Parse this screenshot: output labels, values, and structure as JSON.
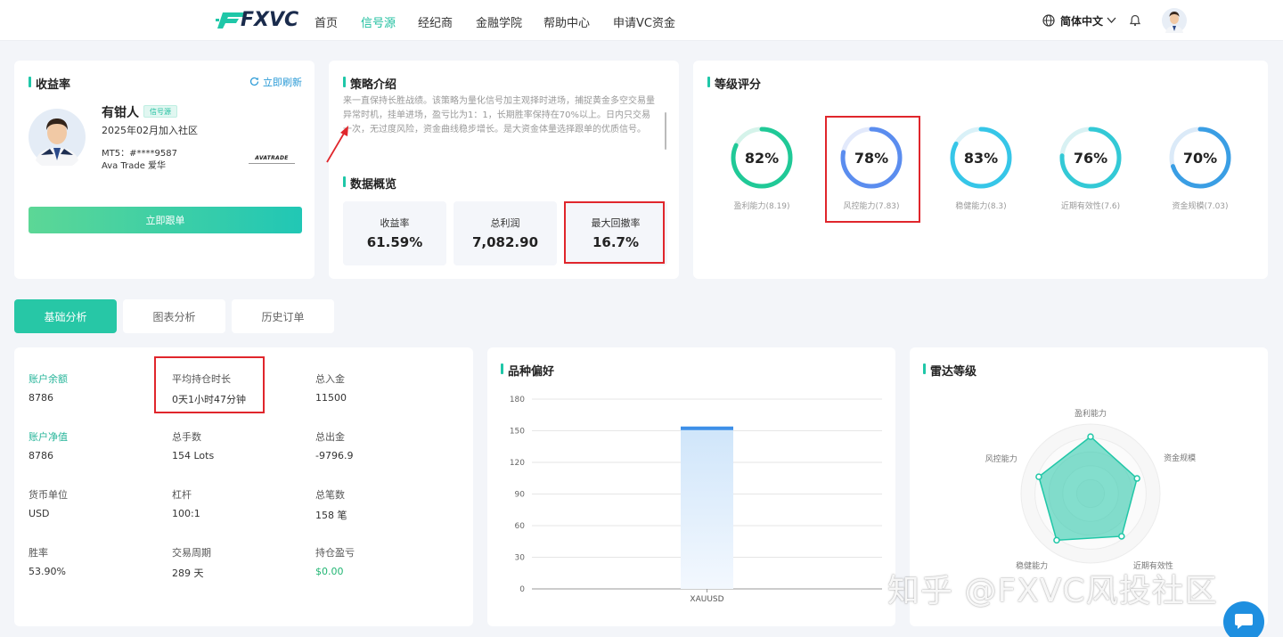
{
  "header": {
    "logo": "FXVC",
    "nav": [
      "首页",
      "信号源",
      "经纪商",
      "金融学院",
      "帮助中心",
      "申请VC资金"
    ],
    "active_nav": "信号源",
    "language": "简体中文"
  },
  "profile": {
    "section_title": "收益率",
    "refresh": "立即刷新",
    "name": "有钳人",
    "badge": "信号源",
    "joined": "2025年02月加入社区",
    "mt5": "MT5：#****9587",
    "broker": "Ava Trade 爱华",
    "broker_logo": "AVATRADE",
    "follow_button": "立即跟单"
  },
  "strategy": {
    "title": "策略介绍",
    "text": "来一直保持长胜战绩。该策略为量化信号加主观择时进场，捕捉黄金多空交易量异常时机，挂单进场，盈亏比为1：1，长期胜率保持在70%以上。日内只交易一次，无过度风险，资金曲线稳步增长。是大资金体量选择跟单的优质信号。"
  },
  "overview": {
    "title": "数据概览",
    "items": [
      {
        "label": "收益率",
        "value": "61.59%"
      },
      {
        "label": "总利润",
        "value": "7,082.90"
      },
      {
        "label": "最大回撤率",
        "value": "16.7%"
      }
    ]
  },
  "rating": {
    "title": "等级评分",
    "gauges": [
      {
        "pct": "82%",
        "value": 82,
        "label": "盈利能力(8.19)",
        "color": "#20c997",
        "track": "#d5f3ea"
      },
      {
        "pct": "78%",
        "value": 78,
        "label": "风控能力(7.83)",
        "color": "#5b8def",
        "track": "#e2e9fb"
      },
      {
        "pct": "83%",
        "value": 83,
        "label": "稳健能力(8.3)",
        "color": "#36c6e8",
        "track": "#d9f1f8"
      },
      {
        "pct": "76%",
        "value": 76,
        "label": "近期有效性(7.6)",
        "color": "#33c9d6",
        "track": "#d8f1f3"
      },
      {
        "pct": "70%",
        "value": 70,
        "label": "资金规模(7.03)",
        "color": "#3a9ee4",
        "track": "#dbeaf8"
      }
    ]
  },
  "tabs": [
    "基础分析",
    "图表分析",
    "历史订单"
  ],
  "stats": [
    {
      "label": "账户余额",
      "value": "8786",
      "accent": true
    },
    {
      "label": "平均持仓时长",
      "value": "0天1小时47分钟"
    },
    {
      "label": "总入金",
      "value": "11500"
    },
    {
      "label": "账户净值",
      "value": "8786",
      "accent": true
    },
    {
      "label": "总手数",
      "value": "154 Lots"
    },
    {
      "label": "总出金",
      "value": "-9796.9"
    },
    {
      "label": "货币单位",
      "value": "USD"
    },
    {
      "label": "杠杆",
      "value": "100:1"
    },
    {
      "label": "总笔数",
      "value": "158 笔"
    },
    {
      "label": "胜率",
      "value": "53.90%"
    },
    {
      "label": "交易周期",
      "value": "289 天"
    },
    {
      "label": "持仓盈亏",
      "value": "$0.00",
      "green": true
    }
  ],
  "preference": {
    "title": "品种偏好",
    "chart_data": {
      "type": "bar",
      "categories": [
        "XAUUSD"
      ],
      "values": [
        154
      ],
      "ylim": [
        0,
        180
      ],
      "yticks": [
        0,
        30,
        60,
        90,
        120,
        150,
        180
      ],
      "ytick_labels": [
        "0",
        "30",
        "60",
        "90",
        "120",
        "150",
        "180"
      ]
    }
  },
  "radar": {
    "title": "雷达等级",
    "axes": [
      "盈利能力",
      "资金规模",
      "近期有效性",
      "稳健能力",
      "风控能力"
    ],
    "values": [
      8.19,
      7.03,
      7.6,
      8.3,
      7.83
    ],
    "max": 10
  },
  "watermark": "知乎 @FXVC风投社区"
}
